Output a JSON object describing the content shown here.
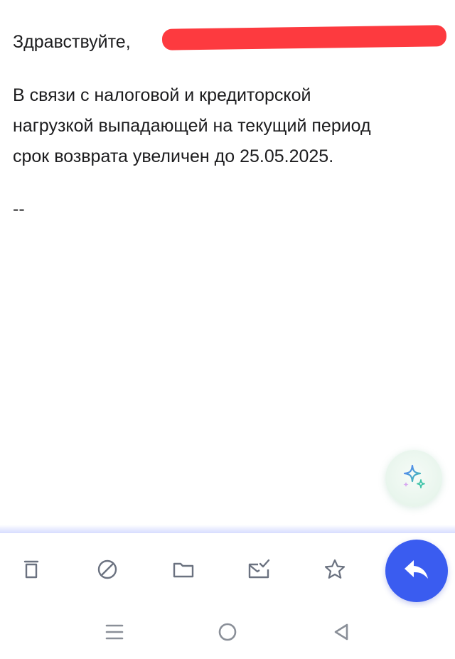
{
  "email": {
    "greeting": "Здравствуйте,",
    "body_lines": [
      "В связи с налоговой и кредиторской",
      "нагрузкой выпадающей на текущий период",
      "срок возврата увеличен до 25.05.2025."
    ],
    "signature": "--"
  },
  "toolbar": {
    "icons": [
      "trash-icon",
      "spam-block-icon",
      "folder-icon",
      "mark-read-icon",
      "star-icon"
    ]
  },
  "fabs": {
    "assistant_icon": "sparkle-icon",
    "reply_icon": "reply-arrow-icon"
  },
  "navbar": {
    "icons": [
      "recent-apps-icon",
      "home-icon",
      "back-icon"
    ]
  },
  "colors": {
    "accent": "#3a5cf0",
    "redaction": "#fd3a3f",
    "icon_gray": "#6b7280"
  }
}
